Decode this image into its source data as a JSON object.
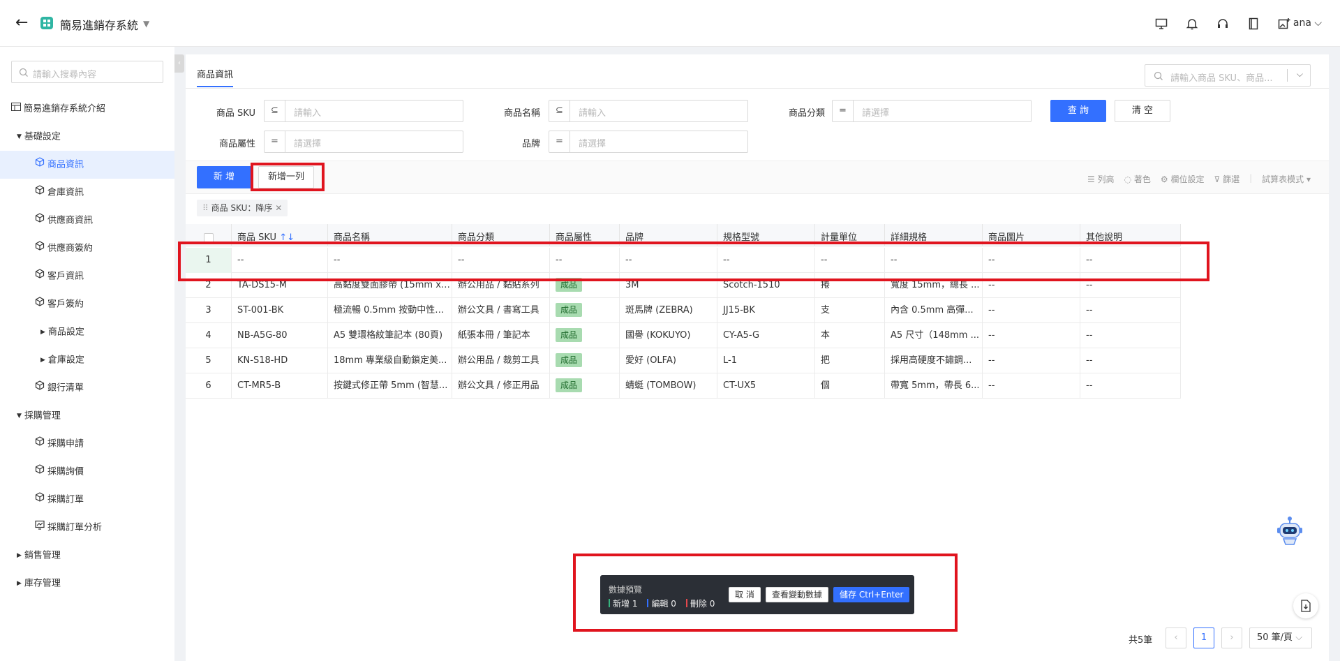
{
  "app": {
    "title": "簡易進銷存系統",
    "user": "ana"
  },
  "sidebar": {
    "search_placeholder": "請輸入搜尋內容",
    "items": [
      {
        "label": "簡易進銷存系統介紹",
        "icon": "table-icon"
      },
      {
        "label": "基礎設定",
        "icon": "caret-down-icon"
      },
      {
        "label": "商品資訊",
        "icon": "cube-icon",
        "active": true
      },
      {
        "label": "倉庫資訊",
        "icon": "cube-icon"
      },
      {
        "label": "供應商資訊",
        "icon": "cube-icon"
      },
      {
        "label": "供應商簽約",
        "icon": "cube-icon"
      },
      {
        "label": "客戶資訊",
        "icon": "cube-icon"
      },
      {
        "label": "客戶簽約",
        "icon": "cube-icon"
      },
      {
        "label": "商品設定",
        "icon": "caret-right-icon"
      },
      {
        "label": "倉庫設定",
        "icon": "caret-right-icon"
      },
      {
        "label": "銀行清單",
        "icon": "cube-icon"
      },
      {
        "label": "採購管理",
        "icon": "caret-down-icon"
      },
      {
        "label": "採購申請",
        "icon": "cube-icon"
      },
      {
        "label": "採購詢價",
        "icon": "cube-icon"
      },
      {
        "label": "採購訂單",
        "icon": "cube-icon"
      },
      {
        "label": "採購訂單分析",
        "icon": "chart-icon"
      },
      {
        "label": "銷售管理",
        "icon": "caret-right-icon"
      },
      {
        "label": "庫存管理",
        "icon": "caret-right-icon"
      }
    ]
  },
  "page": {
    "tab": "商品資訊",
    "top_search_placeholder": "請輸入商品 SKU、商品...",
    "filters": {
      "sku_label": "商品 SKU",
      "sku_placeholder": "請輸入",
      "name_label": "商品名稱",
      "name_placeholder": "請輸入",
      "category_label": "商品分類",
      "category_placeholder": "請選擇",
      "attr_label": "商品屬性",
      "attr_placeholder": "請選擇",
      "brand_label": "品牌",
      "brand_placeholder": "請選擇",
      "op_like": "⊆",
      "op_eq": "="
    },
    "query_button": "查 詢",
    "clear_button": "清 空",
    "add_button": "新 增",
    "add_row_button": "新增一列",
    "tools": {
      "columns": "列高",
      "color": "著色",
      "fields": "欄位設定",
      "filter": "篩選",
      "mode": "試算表模式"
    },
    "sort_tag": "商品 SKU：降序"
  },
  "table": {
    "columns": [
      "商品 SKU",
      "商品名稱",
      "商品分類",
      "商品屬性",
      "品牌",
      "規格型號",
      "計量單位",
      "詳細規格",
      "商品圖片",
      "其他說明"
    ],
    "sort_indicator": "↑↓",
    "rows": [
      {
        "num": "1",
        "sku": "--",
        "name": "--",
        "category": "--",
        "attr": "--",
        "brand": "--",
        "model": "--",
        "unit": "--",
        "spec": "--",
        "image": "--",
        "note": "--"
      },
      {
        "num": "2",
        "sku": "TA-DS15-M",
        "name": "高黏度雙面膠帶 (15mm x ...",
        "category": "辦公用品 / 黏貼系列",
        "attr": "成品",
        "brand": "3M",
        "model": "Scotch-1510",
        "unit": "捲",
        "spec": "寬度 15mm，總長 ...",
        "image": "--",
        "note": "--"
      },
      {
        "num": "3",
        "sku": "ST-001-BK",
        "name": "極流暢 0.5mm 按動中性筆...",
        "category": "辦公文具 / 書寫工具",
        "attr": "成品",
        "brand": "斑馬牌 (ZEBRA)",
        "model": "JJ15-BK",
        "unit": "支",
        "spec": "內含 0.5mm 高彈...",
        "image": "--",
        "note": "--"
      },
      {
        "num": "4",
        "sku": "NB-A5G-80",
        "name": "A5 雙環格紋筆記本 (80頁)",
        "category": "紙張本冊 / 筆記本",
        "attr": "成品",
        "brand": "國譽 (KOKUYO)",
        "model": "CY-A5-G",
        "unit": "本",
        "spec": "A5 尺寸（148mm ...",
        "image": "--",
        "note": "--"
      },
      {
        "num": "5",
        "sku": "KN-S18-HD",
        "name": "18mm 專業級自動鎖定美...",
        "category": "辦公用品 / 裁剪工具",
        "attr": "成品",
        "brand": "愛好 (OLFA)",
        "model": "L-1",
        "unit": "把",
        "spec": "採用高硬度不鏽鋼...",
        "image": "--",
        "note": "--"
      },
      {
        "num": "6",
        "sku": "CT-MR5-B",
        "name": "按鍵式修正帶 5mm (智慧...",
        "category": "辦公文具 / 修正用品",
        "attr": "成品",
        "brand": "蜻蜓 (TOMBOW)",
        "model": "CT-UX5",
        "unit": "個",
        "spec": "帶寬 5mm，帶長 6...",
        "image": "--",
        "note": "--"
      }
    ]
  },
  "preview": {
    "title": "數據預覽",
    "added": "新增 1",
    "edited": "編輯 0",
    "deleted": "刪除 0",
    "cancel": "取 消",
    "view": "查看變動數據",
    "save": "儲存 Ctrl+Enter",
    "colors": {
      "added": "#36b37e",
      "edited": "#3370ff",
      "deleted": "#e5484d"
    }
  },
  "pagination": {
    "total": "共5筆",
    "current": "1",
    "page_size": "50 筆/頁"
  },
  "colors": {
    "accent": "#3370ff",
    "highlight": "#e0141e",
    "tag": "#a8dbb0"
  }
}
